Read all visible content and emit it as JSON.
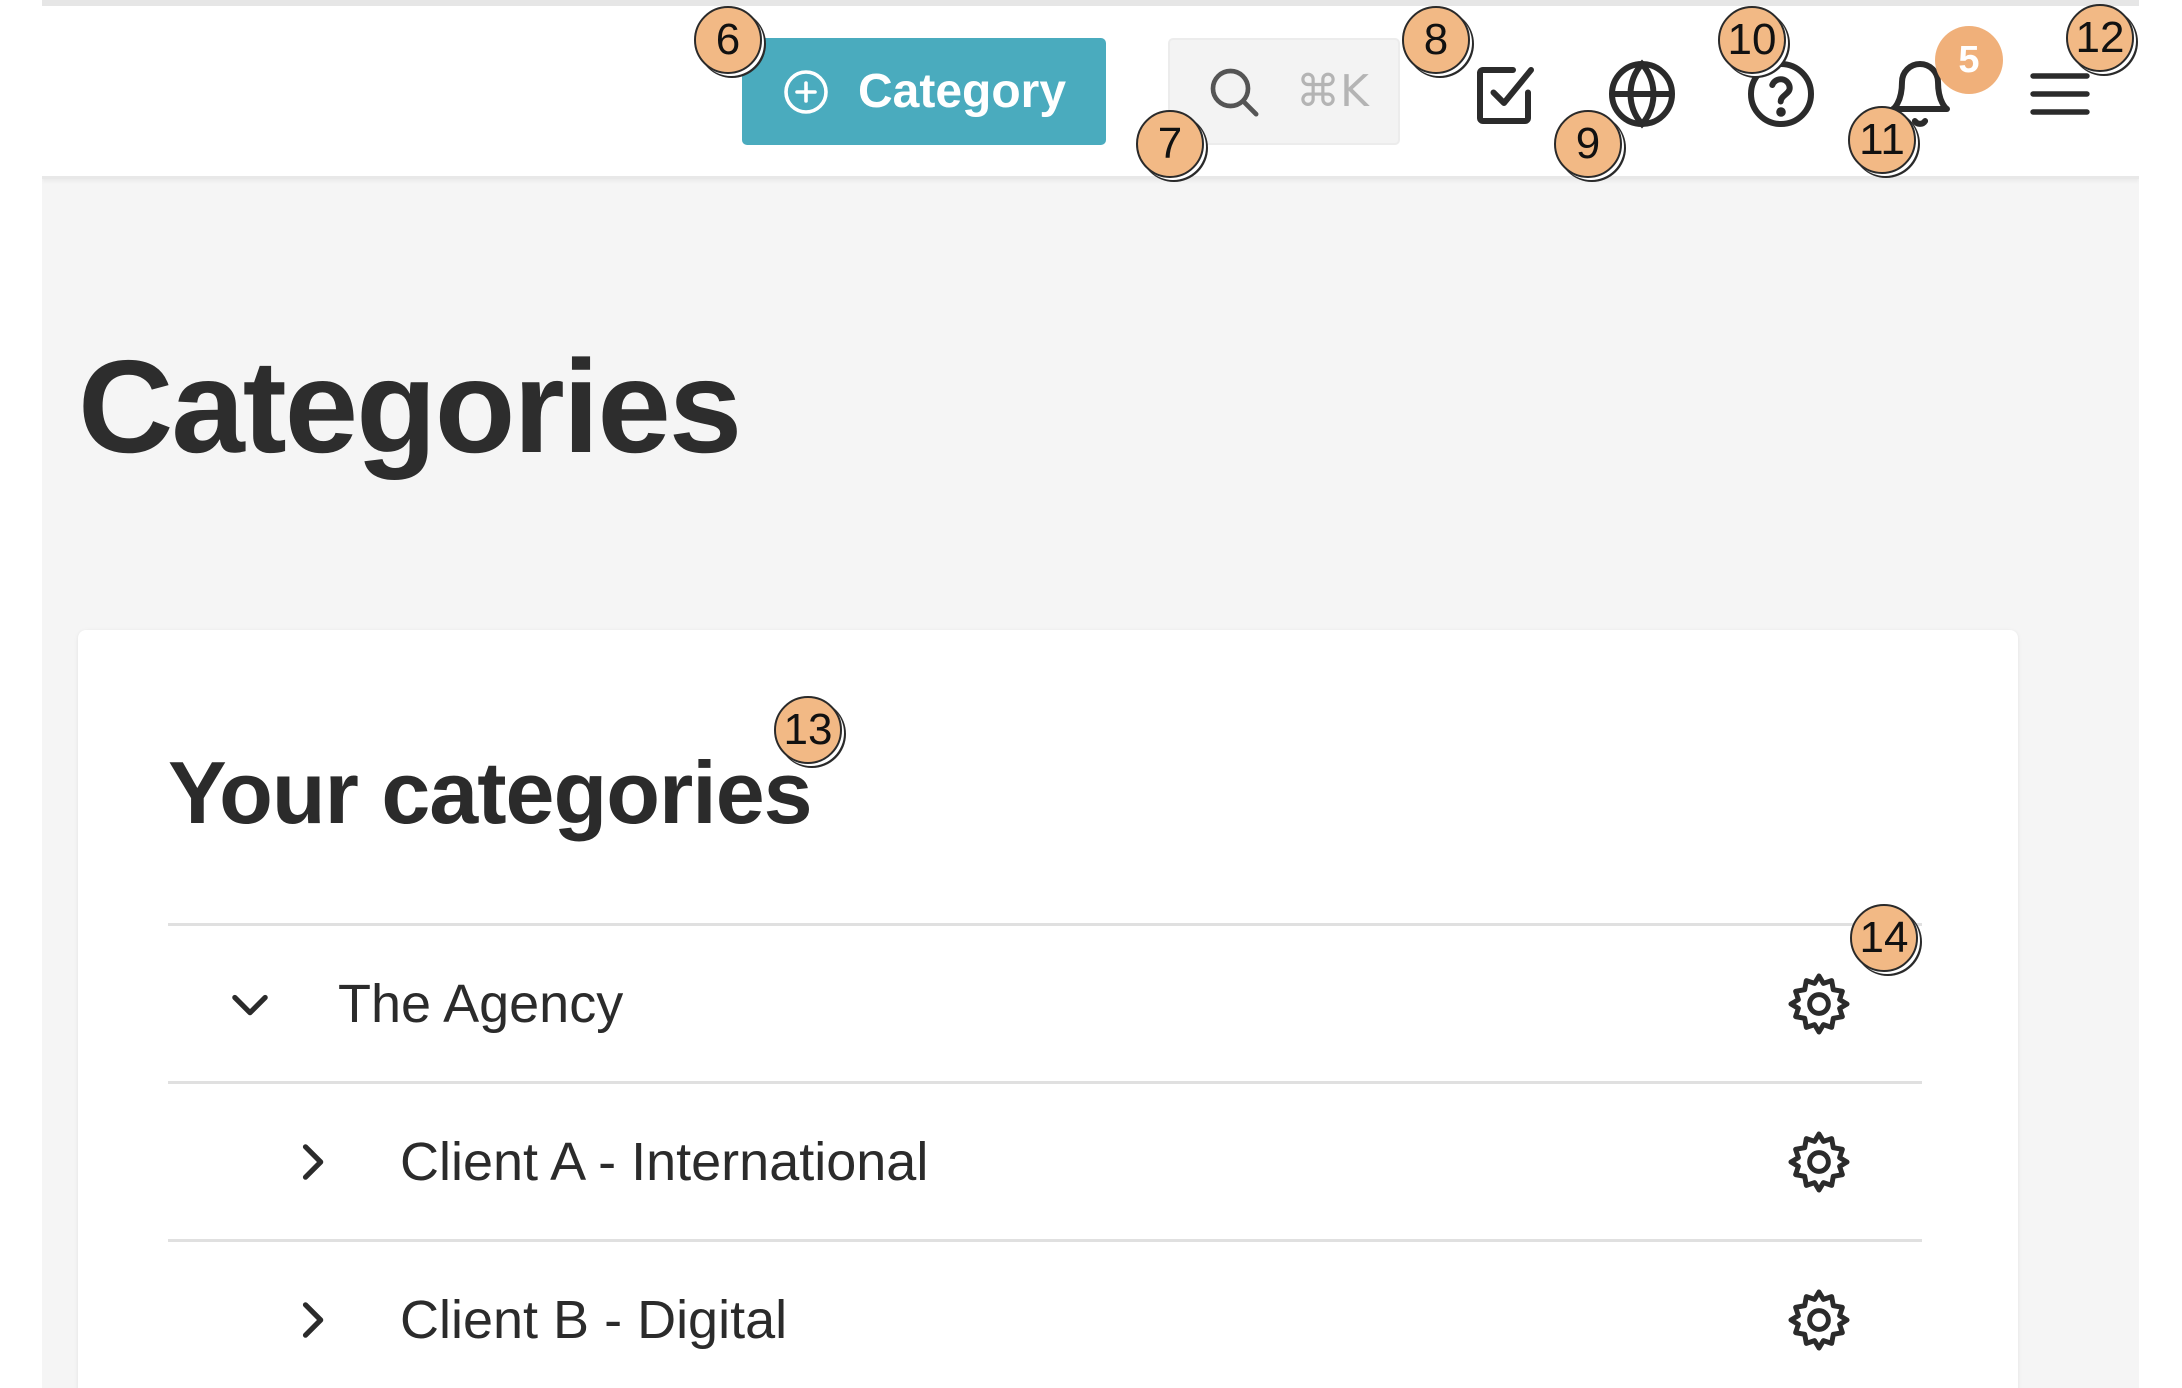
{
  "header": {
    "add_category_label": "Category",
    "search_shortcut": "⌘K",
    "notification_count": "5"
  },
  "icons": {
    "add": "plus-circle-icon",
    "search": "search-icon",
    "tasks": "checkbox-icon",
    "language": "globe-icon",
    "help": "help-icon",
    "notifications": "bell-icon",
    "menu": "menu-icon",
    "row_settings": "gear-icon",
    "expanded": "chevron-down-icon",
    "collapsed": "chevron-right-icon"
  },
  "page": {
    "title": "Categories"
  },
  "card": {
    "title": "Your categories",
    "rows": [
      {
        "label": "The Agency",
        "expanded": true,
        "level": 0
      },
      {
        "label": "Client A - International",
        "expanded": false,
        "level": 1
      },
      {
        "label": "Client B - Digital",
        "expanded": false,
        "level": 1
      }
    ]
  },
  "markers": [
    "6",
    "7",
    "8",
    "9",
    "10",
    "11",
    "12",
    "13",
    "14"
  ],
  "colors": {
    "accent": "#4aabbe",
    "badge": "#f0b07a",
    "marker": "#f2b985",
    "background": "#f5f5f5"
  }
}
